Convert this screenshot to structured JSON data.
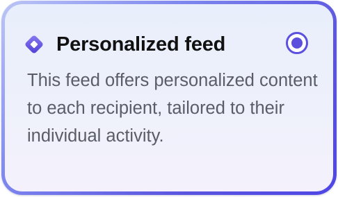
{
  "card": {
    "title": "Personalized feed",
    "description": "This feed offers personalized content to each recipient, tailored to their individual activity.",
    "selected": true,
    "icon": "diamond-feed-icon"
  },
  "colors": {
    "accent": "#5b4fde",
    "border_gradient_start": "#bcc6f6",
    "border_gradient_end": "#4f46e5",
    "card_background": "#eaeffb",
    "title": "#111111",
    "description": "#5a5d66"
  }
}
